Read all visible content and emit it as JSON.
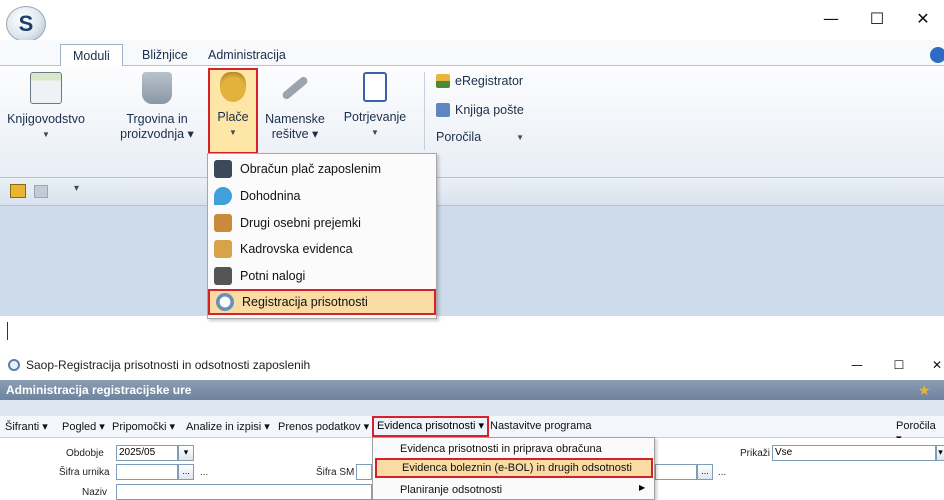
{
  "window": {
    "minimize": "—",
    "maximize": "☐",
    "close": "✕"
  },
  "logo_text": "S",
  "tabs": [
    "Moduli",
    "Bližnjice",
    "Administracija"
  ],
  "ribbon": {
    "buttons": [
      {
        "label": "Knjigovodstvo",
        "arrow": "▼"
      },
      {
        "label": "Trgovina in",
        "label2": "proizvodnja ▾"
      },
      {
        "label": "Plače",
        "arrow": "▼"
      },
      {
        "label": "Namenske",
        "label2": "rešitve ▾"
      },
      {
        "label": "Potrjevanje",
        "arrow": "▼"
      }
    ],
    "small": [
      {
        "label": "eRegistrator"
      },
      {
        "label": "Knjiga pošte"
      },
      {
        "label": "Poročila",
        "arrow": "▼"
      }
    ]
  },
  "qat_arrow": "▾",
  "dropdown": [
    "Obračun plač zaposlenim",
    "Dohodnina",
    "Drugi osebni prejemki",
    "Kadrovska evidenca",
    "Potni nalogi",
    "Registracija prisotnosti"
  ],
  "sub_window": {
    "title": "Saop-Registracija prisotnosti in odsotnosti zaposlenih",
    "header": "Administracija registracijske ure",
    "menubar": [
      "Šifranti ▾",
      "Pogled ▾",
      "Pripomočki ▾",
      "Analize in izpisi ▾",
      "Prenos podatkov ▾",
      "Evidenca prisotnosti ▾",
      "Nastavitve programa",
      "Poročila ▾"
    ],
    "form": {
      "obdobje_label": "Obdobje",
      "obdobje_value": "2025/05",
      "sifra_urnika_label": "Šifra urnika",
      "naziv_label": "Naziv",
      "sifra_sm_label": "Šifra SM",
      "prikazi_label": "Prikaži",
      "prikazi_value": "Vse",
      "ellipsis": "..."
    },
    "submenu": [
      "Evidenca prisotnosti in priprava obračuna",
      "Evidenca boleznin (e-BOL) in drugih odsotnosti",
      "Planiranje odsotnosti"
    ],
    "submenu_arrow": "▶"
  }
}
